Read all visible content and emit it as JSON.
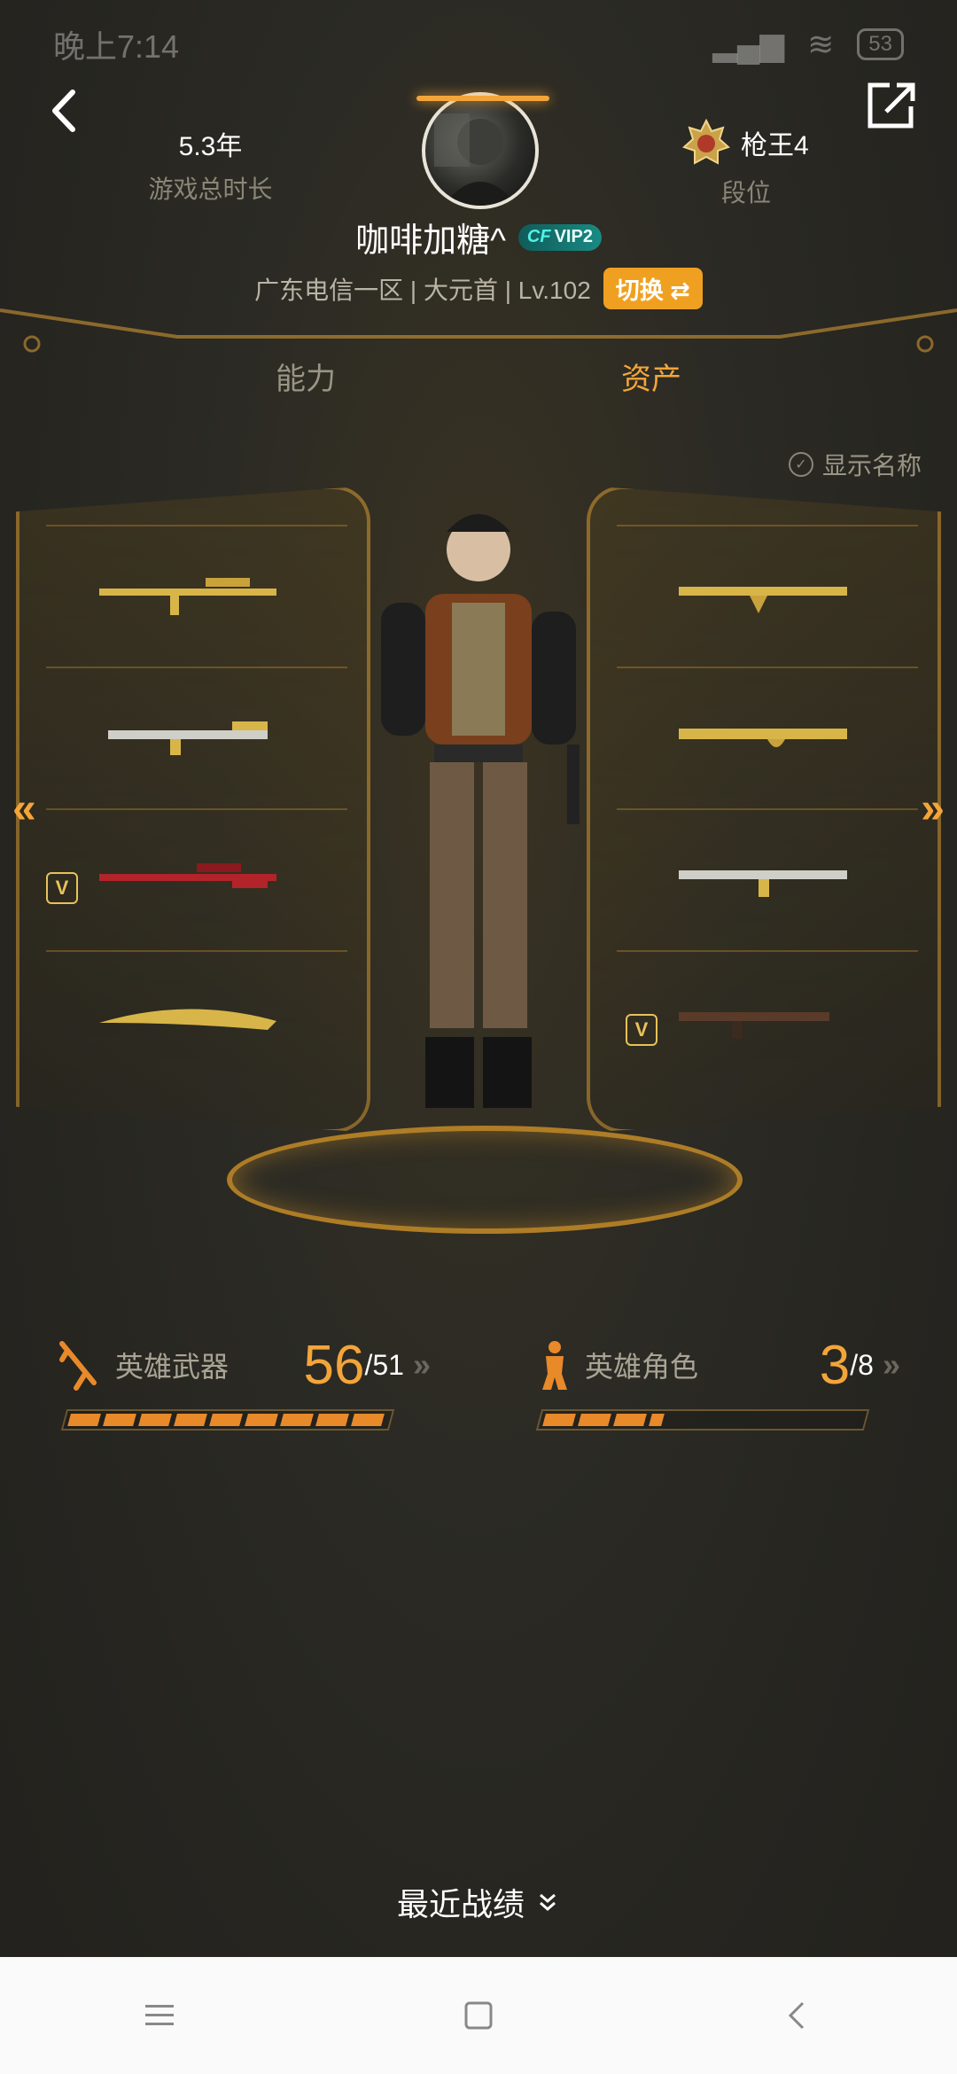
{
  "status_bar": {
    "time": "晚上7:14",
    "battery": "53"
  },
  "header": {
    "play_time_value": "5.3年",
    "play_time_label": "游戏总时长",
    "rank_value": "枪王4",
    "rank_label": "段位",
    "nickname": "咖啡加糖^",
    "vip_badge": "VIP2",
    "server_info": "广东电信一区 | 大元首 | Lv.102",
    "switch_label": "切换 ⇄"
  },
  "tabs": [
    {
      "label": "能力",
      "active": false
    },
    {
      "label": "资产",
      "active": true
    }
  ],
  "show_name_label": "显示名称",
  "loadout": {
    "left": [
      {
        "icon": "sniper-rifle-gold"
      },
      {
        "icon": "assault-rifle-gold"
      },
      {
        "icon": "sniper-rifle-red",
        "badge": "V"
      },
      {
        "icon": "knife-gold"
      }
    ],
    "right": [
      {
        "icon": "ak-rifle-gold"
      },
      {
        "icon": "ak-rifle-gold-dragon"
      },
      {
        "icon": "m4-rifle-gold"
      },
      {
        "icon": "smg-dark",
        "badge": "V"
      }
    ]
  },
  "hero_weapons": {
    "label": "英雄武器",
    "count": "56",
    "total": "/51",
    "progress": 1.0
  },
  "hero_characters": {
    "label": "英雄角色",
    "count": "3",
    "total": "/8",
    "progress": 0.375
  },
  "recent_label": "最近战绩",
  "colors": {
    "accent": "#f3a53a",
    "switch_bg": "#f0a020",
    "vip_bg": "#1a8a84",
    "bg": "#262520"
  }
}
